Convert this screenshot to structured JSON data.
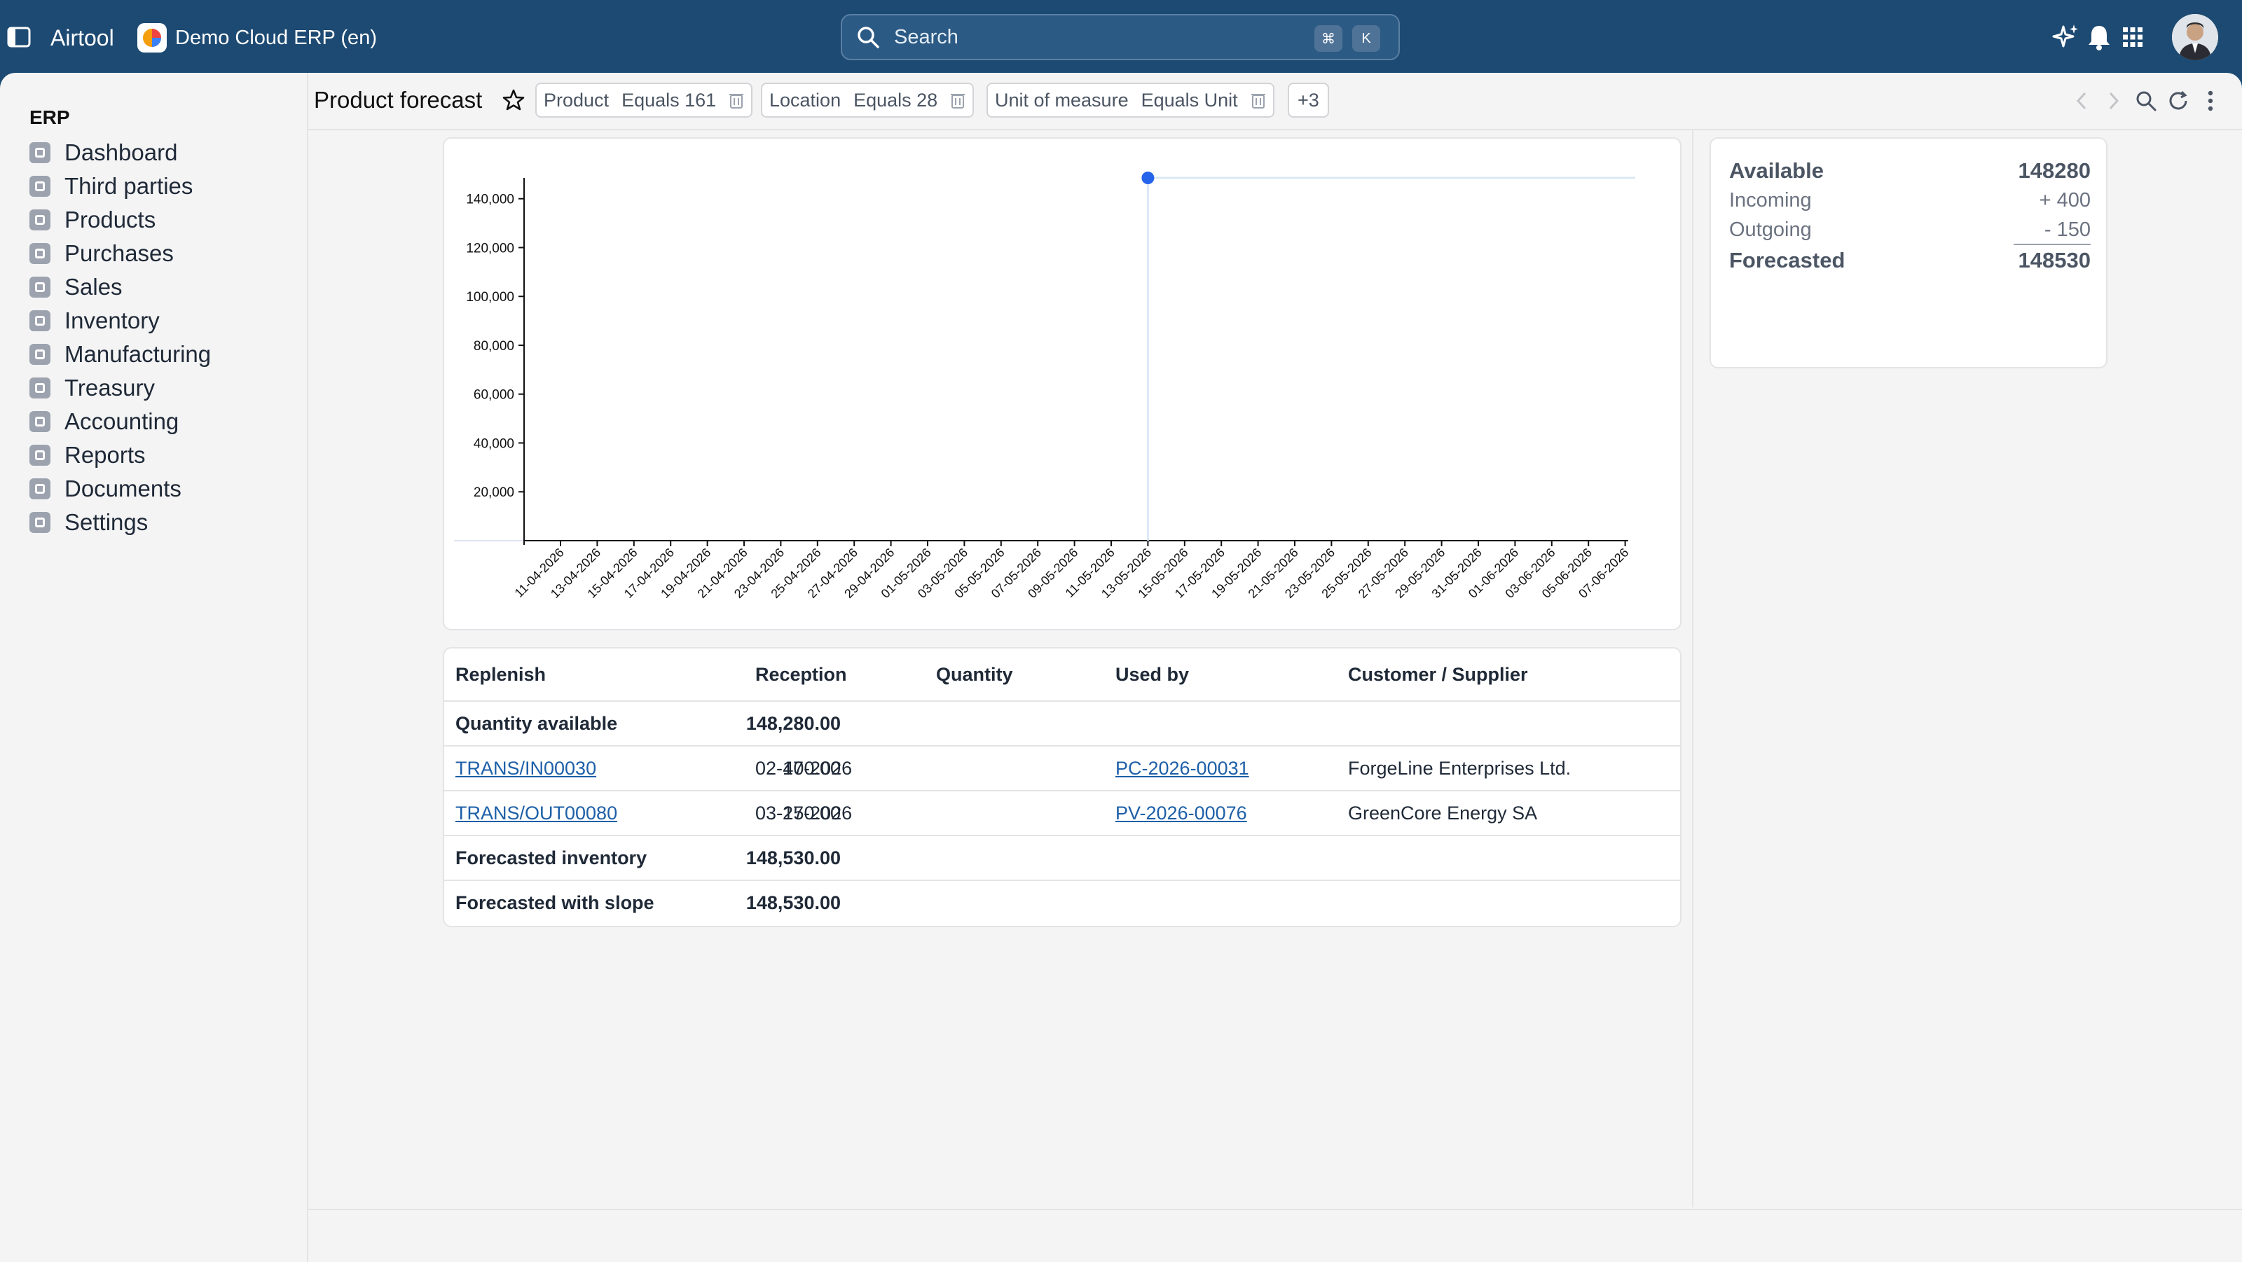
{
  "topbar": {
    "brand": "Airtool",
    "company": "Demo Cloud ERP (en)",
    "search_placeholder": "Search",
    "shortcut_key1": "⌘",
    "shortcut_key2": "K"
  },
  "sidebar": {
    "title": "ERP",
    "items": [
      {
        "label": "Dashboard"
      },
      {
        "label": "Third parties"
      },
      {
        "label": "Products"
      },
      {
        "label": "Purchases"
      },
      {
        "label": "Sales"
      },
      {
        "label": "Inventory"
      },
      {
        "label": "Manufacturing"
      },
      {
        "label": "Treasury"
      },
      {
        "label": "Accounting"
      },
      {
        "label": "Reports"
      },
      {
        "label": "Documents"
      },
      {
        "label": "Settings"
      }
    ]
  },
  "header": {
    "title": "Product forecast",
    "filters": [
      {
        "field": "Product",
        "value": "Equals 161"
      },
      {
        "field": "Location",
        "value": "Equals 28"
      },
      {
        "field": "Unit of measure",
        "value": "Equals Unit"
      }
    ],
    "more_filters": "+3"
  },
  "summary": {
    "available_label": "Available",
    "available_value": "148280",
    "incoming_label": "Incoming",
    "incoming_value": "+ 400",
    "outgoing_label": "Outgoing",
    "outgoing_value": "- 150",
    "forecasted_label": "Forecasted",
    "forecasted_value": "148530"
  },
  "table": {
    "headers": [
      "Replenish",
      "Reception",
      "Quantity",
      "Used by",
      "Customer / Supplier"
    ],
    "rows": [
      {
        "replenish": "Quantity available",
        "reception": "",
        "quantity": "148,280.00",
        "used_by": "",
        "party": ""
      },
      {
        "replenish": "TRANS/IN00030",
        "reception": "02-17-2026",
        "quantity": "400.00",
        "used_by": "PC-2026-00031",
        "party": "ForgeLine Enterprises Ltd."
      },
      {
        "replenish": "TRANS/OUT00080",
        "reception": "03-27-2026",
        "quantity": "-150.00",
        "used_by": "PV-2026-00076",
        "party": "GreenCore Energy SA"
      },
      {
        "replenish": "Forecasted inventory",
        "reception": "",
        "quantity": "148,530.00",
        "used_by": "",
        "party": ""
      },
      {
        "replenish": "Forecasted with slope",
        "reception": "",
        "quantity": "148,530.00",
        "used_by": "",
        "party": ""
      }
    ]
  },
  "chart_data": {
    "type": "line",
    "yticks": [
      "20,000",
      "40,000",
      "60,000",
      "80,000",
      "100,000",
      "120,000",
      "140,000"
    ],
    "ylim": [
      0,
      148530
    ],
    "xticks": [
      "11-04-2026",
      "13-04-2026",
      "15-04-2026",
      "17-04-2026",
      "19-04-2026",
      "21-04-2026",
      "23-04-2026",
      "25-04-2026",
      "27-04-2026",
      "29-04-2026",
      "01-05-2026",
      "03-05-2026",
      "05-05-2026",
      "07-05-2026",
      "09-05-2026",
      "11-05-2026",
      "13-05-2026",
      "15-05-2026",
      "17-05-2026",
      "19-05-2026",
      "21-05-2026",
      "23-05-2026",
      "25-05-2026",
      "27-05-2026",
      "29-05-2026",
      "31-05-2026",
      "01-06-2026",
      "03-06-2026",
      "05-06-2026",
      "07-06-2026"
    ],
    "series": [
      {
        "points": [
          {
            "x": "13-05-2026",
            "y": 0
          },
          {
            "x": "13-05-2026",
            "y": 148530
          },
          {
            "x": "07-06-2026",
            "y": 148530
          }
        ]
      }
    ],
    "highlight": {
      "x": "13-05-2026",
      "y": 148530
    },
    "colors": {
      "line": "#dbe8f6",
      "point": "#2563eb"
    }
  }
}
